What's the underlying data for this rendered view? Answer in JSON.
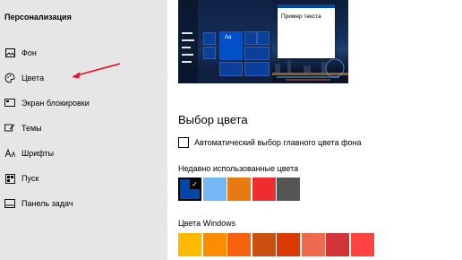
{
  "sidebar": {
    "title": "Персонализация",
    "items": [
      {
        "label": "Фон",
        "icon": "picture-icon"
      },
      {
        "label": "Цвета",
        "icon": "palette-icon"
      },
      {
        "label": "Экран блокировки",
        "icon": "lock-screen-icon"
      },
      {
        "label": "Темы",
        "icon": "brush-icon"
      },
      {
        "label": "Шрифты",
        "icon": "font-icon"
      },
      {
        "label": "Пуск",
        "icon": "start-icon"
      },
      {
        "label": "Панель задач",
        "icon": "taskbar-icon"
      }
    ]
  },
  "preview": {
    "tile_label": "Aa",
    "window_text": "Пример текста"
  },
  "color_section": {
    "title": "Выбор цвета",
    "auto_checkbox_label": "Автоматический выбор главного цвета фона",
    "auto_checked": false,
    "recent_title": "Недавно использованные цвета",
    "recent_colors": [
      "#0047ab",
      "#74b7f4",
      "#e87a10",
      "#ee2e2e",
      "#555555"
    ],
    "selected_recent_index": 0,
    "windows_title": "Цвета Windows",
    "windows_colors": [
      "#ffb900",
      "#ff8c00",
      "#f7630c",
      "#ca5010",
      "#da3b01",
      "#ef6950",
      "#d13438",
      "#ff4343"
    ]
  },
  "annotation_color": "#e81123"
}
